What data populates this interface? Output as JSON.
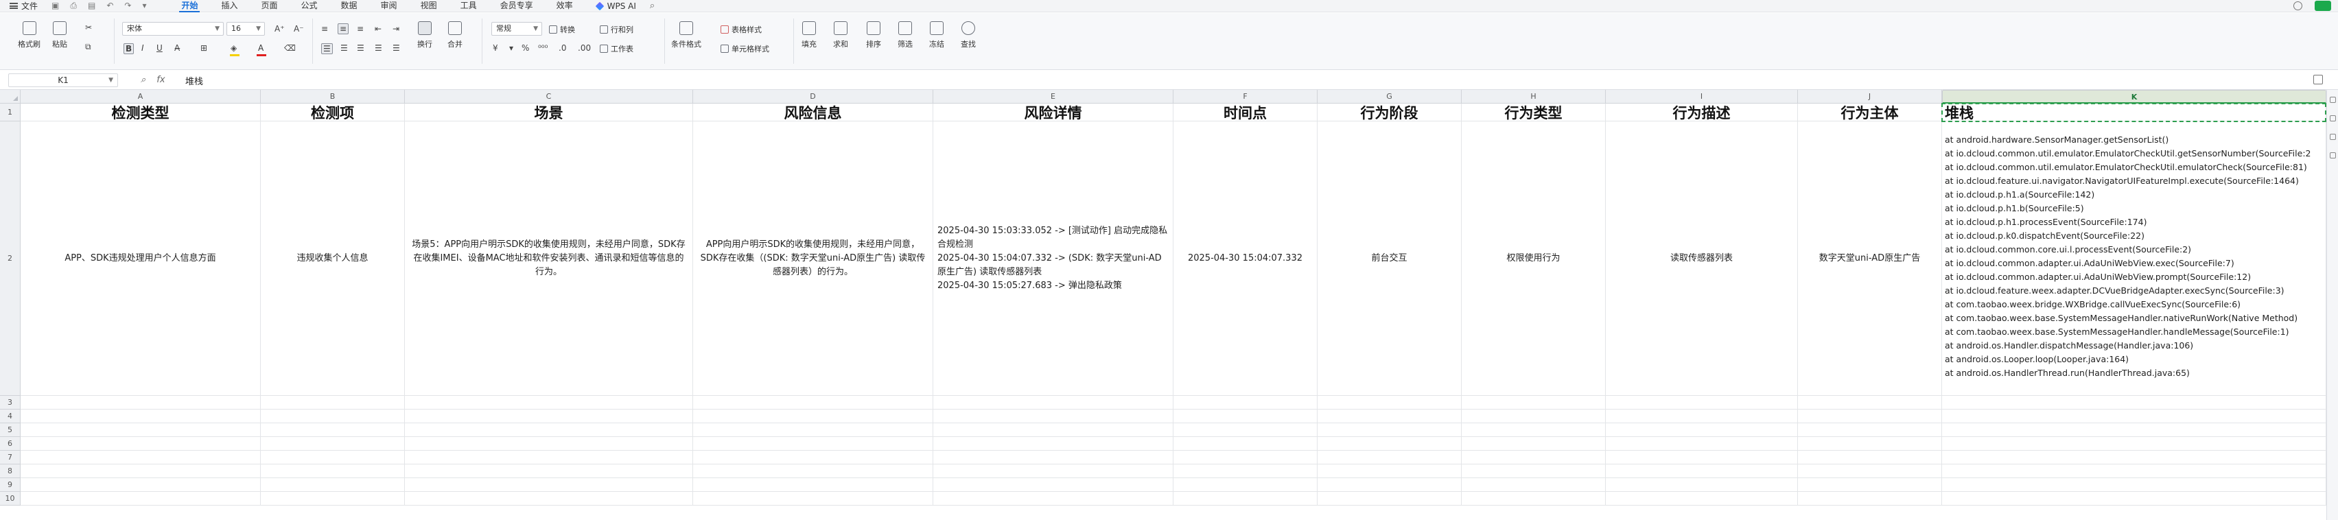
{
  "menubar": {
    "file_label": "文件",
    "tabs": [
      "开始",
      "插入",
      "页面",
      "公式",
      "数据",
      "审阅",
      "视图",
      "工具",
      "会员专享",
      "效率"
    ],
    "active_tab": "开始",
    "wps_ai_label": "WPS AI"
  },
  "ribbon": {
    "format_painter": "格式刷",
    "paste": "粘贴",
    "font_name": "宋体",
    "font_size": "16",
    "wrap": "换行",
    "merge": "合并",
    "number_format": "常规",
    "convert": "转换",
    "row_col": "行和列",
    "worksheet": "工作表",
    "conditional_format": "条件格式",
    "table_style": "表格样式",
    "cell_style": "单元格样式",
    "fill": "填充",
    "sum": "求和",
    "sort": "排序",
    "filter": "筛选",
    "freeze": "冻结",
    "find": "查找",
    "font_color_hex": "#e02020",
    "highlight_color_hex": "#f5d000"
  },
  "formula_bar": {
    "name_box": "K1",
    "content": "堆栈"
  },
  "columns": [
    "A",
    "B",
    "C",
    "D",
    "E",
    "F",
    "G",
    "H",
    "I",
    "J",
    "K"
  ],
  "selected_column": "K",
  "rows": [
    "1",
    "2",
    "3",
    "4",
    "5",
    "6",
    "7",
    "8",
    "9",
    "10"
  ],
  "header_row": [
    "检测类型",
    "检测项",
    "场景",
    "风险信息",
    "风险详情",
    "时间点",
    "行为阶段",
    "行为类型",
    "行为描述",
    "行为主体",
    "堆栈"
  ],
  "data_row": {
    "type": "APP、SDK违规处理用户个人信息方面",
    "item": "违规收集个人信息",
    "scene": "场景5：APP向用户明示SDK的收集使用规则，未经用户同意，SDK存在收集IMEI、设备MAC地址和软件安装列表、通讯录和短信等信息的行为。",
    "risk_info": "APP向用户明示SDK的收集使用规则，未经用户同意，SDK存在收集（(SDK: 数字天堂uni-AD原生广告) 读取传感器列表）的行为。",
    "risk_detail": [
      "2025-04-30 15:03:33.052 -> [测试动作] 启动完成隐私合规检测",
      "2025-04-30 15:04:07.332 -> (SDK: 数字天堂uni-AD原生广告) 读取传感器列表",
      "2025-04-30 15:05:27.683 -> 弹出隐私政策"
    ],
    "time": "2025-04-30 15:04:07.332",
    "stage": "前台交互",
    "behavior_type": "权限使用行为",
    "behavior_desc": "读取传感器列表",
    "subject": "数字天堂uni-AD原生广告",
    "stack": [
      "at android.hardware.SensorManager.getSensorList()",
      "at io.dcloud.common.util.emulator.EmulatorCheckUtil.getSensorNumber(SourceFile:2",
      "at io.dcloud.common.util.emulator.EmulatorCheckUtil.emulatorCheck(SourceFile:81)",
      "at io.dcloud.feature.ui.navigator.NavigatorUIFeatureImpl.execute(SourceFile:1464)",
      "at io.dcloud.p.h1.a(SourceFile:142)",
      "at io.dcloud.p.h1.b(SourceFile:5)",
      "at io.dcloud.p.h1.processEvent(SourceFile:174)",
      "at io.dcloud.p.k0.dispatchEvent(SourceFile:22)",
      "at io.dcloud.common.core.ui.l.processEvent(SourceFile:2)",
      "at io.dcloud.common.adapter.ui.AdaUniWebView.exec(SourceFile:7)",
      "at io.dcloud.common.adapter.ui.AdaUniWebView.prompt(SourceFile:12)",
      "at io.dcloud.feature.weex.adapter.DCVueBridgeAdapter.execSync(SourceFile:3)",
      "at com.taobao.weex.bridge.WXBridge.callVueExecSync(SourceFile:6)",
      "at com.taobao.weex.base.SystemMessageHandler.nativeRunWork(Native Method)",
      "at com.taobao.weex.base.SystemMessageHandler.handleMessage(SourceFile:1)",
      "at android.os.Handler.dispatchMessage(Handler.java:106)",
      "at android.os.Looper.loop(Looper.java:164)",
      "at android.os.HandlerThread.run(HandlerThread.java:65)"
    ]
  }
}
